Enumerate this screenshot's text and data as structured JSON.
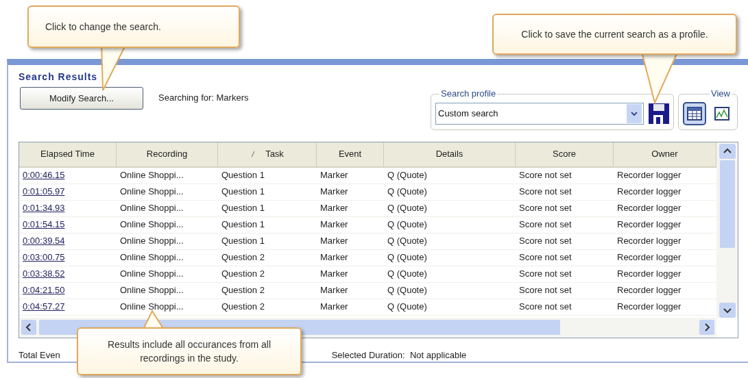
{
  "callouts": [
    {
      "text": "Click to change the search."
    },
    {
      "text": "Click to save the current search as a profile."
    },
    {
      "text": "Results include all occurances from all recordings in the study."
    }
  ],
  "panel": {
    "title": "Search Results",
    "modify_button": "Modify Search...",
    "searching_for": "Searching for: Markers",
    "search_profile": {
      "label": "Search profile",
      "value": "Custom search"
    },
    "view": {
      "label": "View",
      "options": [
        {
          "kind": "table",
          "selected": true
        },
        {
          "kind": "chart",
          "selected": false
        }
      ]
    }
  },
  "table": {
    "columns": [
      {
        "label": "Elapsed Time",
        "sorted": false
      },
      {
        "label": "Recording",
        "sorted": false
      },
      {
        "label": "Task",
        "sorted": true
      },
      {
        "label": "Event",
        "sorted": false
      },
      {
        "label": "Details",
        "sorted": false
      },
      {
        "label": "Score",
        "sorted": false
      },
      {
        "label": "Owner",
        "sorted": false
      }
    ],
    "rows": [
      [
        "0:00:46.15",
        "Online Shoppi...",
        "Question 1",
        "Marker",
        "Q (Quote)",
        "Score not set",
        "Recorder logger"
      ],
      [
        "0:01:05.97",
        "Online Shoppi...",
        "Question 1",
        "Marker",
        "Q (Quote)",
        "Score not set",
        "Recorder logger"
      ],
      [
        "0:01:34.93",
        "Online Shoppi...",
        "Question 1",
        "Marker",
        "Q (Quote)",
        "Score not set",
        "Recorder logger"
      ],
      [
        "0:01:54.15",
        "Online Shoppi...",
        "Question 1",
        "Marker",
        "Q (Quote)",
        "Score not set",
        "Recorder logger"
      ],
      [
        "0:00:39.54",
        "Online Shoppi...",
        "Question 1",
        "Marker",
        "Q (Quote)",
        "Score not set",
        "Recorder logger"
      ],
      [
        "0:03:00.75",
        "Online Shoppi...",
        "Question 2",
        "Marker",
        "Q (Quote)",
        "Score not set",
        "Recorder logger"
      ],
      [
        "0:03:38.52",
        "Online Shoppi...",
        "Question 2",
        "Marker",
        "Q (Quote)",
        "Score not set",
        "Recorder logger"
      ],
      [
        "0:04:21.50",
        "Online Shoppi...",
        "Question 2",
        "Marker",
        "Q (Quote)",
        "Score not set",
        "Recorder logger"
      ],
      [
        "0:04:57.27",
        "Online Shoppi...",
        "Question 2",
        "Marker",
        "Q (Quote)",
        "Score not set",
        "Recorder logger"
      ]
    ]
  },
  "footer": {
    "total": "Total Even",
    "selected_duration": "Selected Duration:  Not applicable"
  }
}
